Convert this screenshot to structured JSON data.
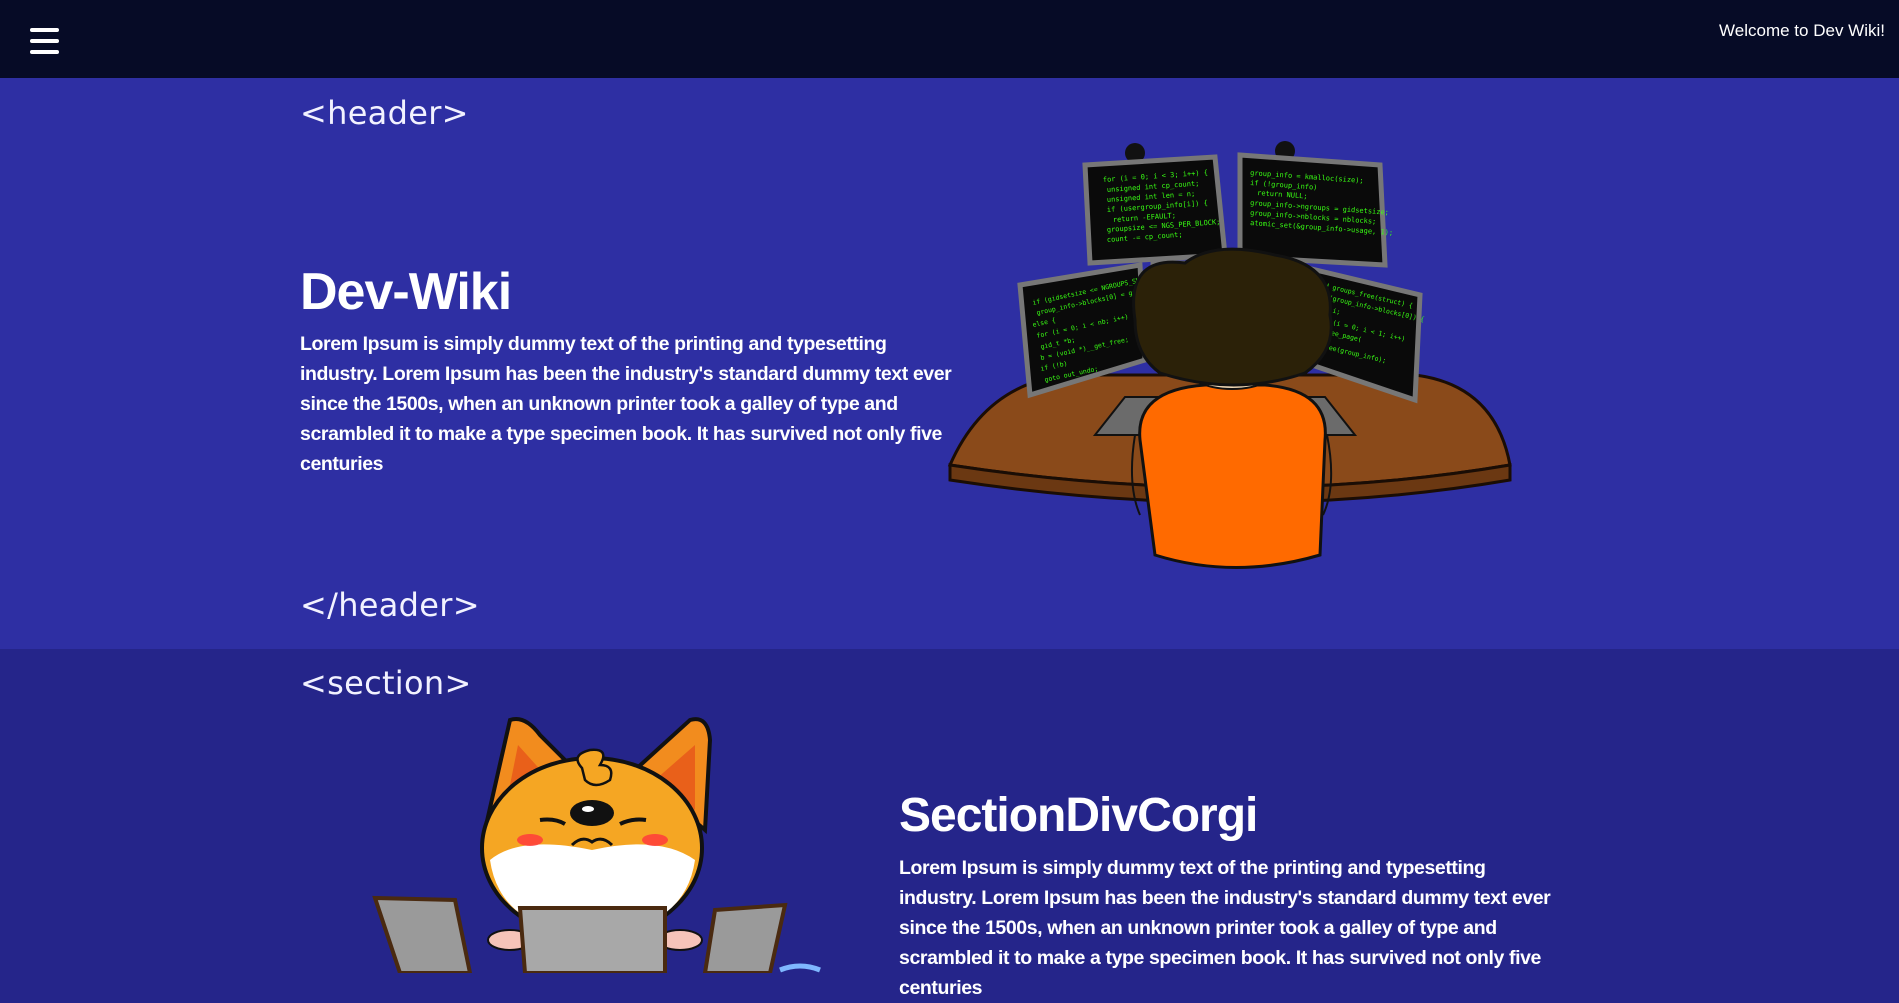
{
  "nav": {
    "welcome": "Welcome to Dev Wiki!"
  },
  "header": {
    "open_tag": "<header>",
    "close_tag": "</header>",
    "title": "Dev-Wiki",
    "body": "Lorem Ipsum is simply dummy text of the printing and typesetting industry. Lorem Ipsum has been the industry's standard dummy text ever since the 1500s, when an unknown printer took a galley of type and scrambled it to make a type specimen book. It has survived not only five centuries"
  },
  "section": {
    "open_tag": "<section>",
    "title": "SectionDivCorgi",
    "body": "Lorem Ipsum is simply dummy text of the printing and typesetting industry. Lorem Ipsum has been the industry's standard dummy text ever since the 1500s, when an unknown printer took a galley of type and scrambled it to make a type specimen book. It has survived not only five centuries"
  },
  "colors": {
    "nav_bg": "#060b26",
    "header_bg": "#2e2fa3",
    "section_bg": "#25258a",
    "code_green": "#39ff14",
    "shirt_orange": "#ff6a00"
  },
  "icons": [
    "menu-hamburger-icon",
    "developer-at-monitors-illustration",
    "corgi-with-laptops-illustration"
  ]
}
